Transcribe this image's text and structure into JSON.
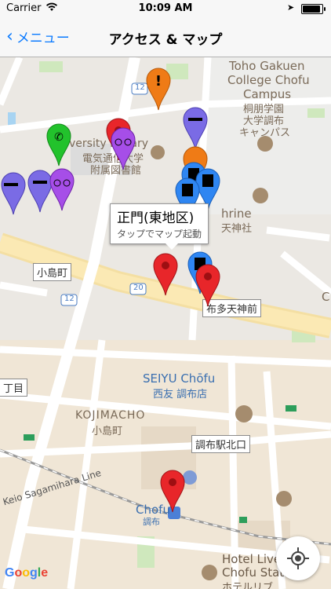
{
  "status_bar": {
    "carrier": "Carrier",
    "time": "10:09 AM"
  },
  "nav": {
    "back_label": "メニュー",
    "title": "アクセス & マップ"
  },
  "callout": {
    "title": "正門(東地区)",
    "subtitle": "タップでマップ起動"
  },
  "map_labels": {
    "toho1": "Toho Gakuen",
    "toho2": "College Chofu",
    "toho3": "Campus",
    "toho_jp1": "桐朋学園",
    "toho_jp2": "大学調布",
    "toho_jp3": "キャンパス",
    "univ_lib": "versity Library",
    "uec_jp1": "電気通信大学",
    "uec_jp2": "附属図書館",
    "shrine_en": "hrine",
    "shrine_jp": "天神社",
    "kojima_cho": "小島町",
    "fuda_tenjin": "布多天神前",
    "chome": "丁目",
    "seiyu_en": "SEIYU Chōfu",
    "seiyu_jp": "西友 調布店",
    "kojimacho_en": "KOJIMACHO",
    "kojimacho_jp": "小島町",
    "chofu_north": "調布駅北口",
    "keio_line": "Keio Sagamihara Line",
    "chofu_en": "Chofu",
    "chofu_jp": "調布",
    "hotel1": "Hotel Live",
    "hotel2": "Chofu Stati",
    "hotel_jp": "ホテルリブ",
    "route12a": "12",
    "route12b": "12",
    "route20": "20",
    "c_edge": "C"
  },
  "google_logo": [
    "G",
    "o",
    "o",
    "g",
    "l",
    "e"
  ],
  "colors": {
    "accent": "#0a7aff",
    "pin_red": "#e8262a",
    "pin_purple": "#a64ee8",
    "pin_orange": "#ef7b16",
    "pin_green": "#22c22c",
    "pin_blue": "#2f86f2",
    "pin_violet": "#7a6be5"
  }
}
